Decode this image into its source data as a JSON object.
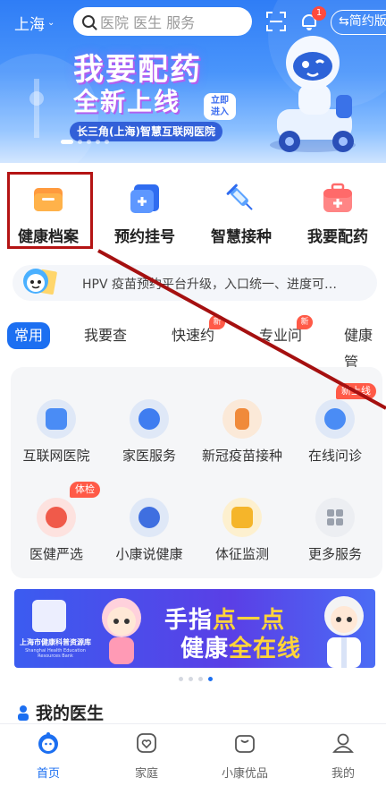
{
  "header": {
    "city": "上海",
    "search_placeholder": "医院 医生 服务",
    "notification_count": "1",
    "simple_mode_label": "简约版"
  },
  "hero_banner": {
    "title_line1": "我要配药",
    "title_line2": "全新上线",
    "enter_label_1": "立即",
    "enter_label_2": "进入",
    "subtitle": "长三角(上海)智慧互联网医院"
  },
  "quick_entries": [
    {
      "label": "健康档案",
      "icon": "folder-icon"
    },
    {
      "label": "预约挂号",
      "icon": "appointment-icon"
    },
    {
      "label": "智慧接种",
      "icon": "syringe-icon"
    },
    {
      "label": "我要配药",
      "icon": "medicine-kit-icon"
    }
  ],
  "notice": {
    "text": "HPV 疫苗预约平台升级，入口统一、进度可…"
  },
  "tabs": [
    {
      "label": "常用",
      "active": true
    },
    {
      "label": "我要查"
    },
    {
      "label": "快速约",
      "badge": "新"
    },
    {
      "label": "专业问",
      "badge": "新"
    },
    {
      "label": "健康管"
    }
  ],
  "services": {
    "corner_ribbon": "新上线",
    "items": [
      {
        "label": "互联网医院",
        "icon": "hospital-icon"
      },
      {
        "label": "家医服务",
        "icon": "family-doctor-icon"
      },
      {
        "label": "新冠疫苗接种",
        "icon": "vaccine-bottle-icon"
      },
      {
        "label": "在线问诊",
        "icon": "online-consult-icon"
      },
      {
        "label": "医健严选",
        "icon": "select-badge-icon",
        "badge": "体检"
      },
      {
        "label": "小康说健康",
        "icon": "graduate-icon"
      },
      {
        "label": "体征监测",
        "icon": "monitor-icon"
      },
      {
        "label": "更多服务",
        "icon": "grid-more-icon"
      }
    ]
  },
  "ad_banner": {
    "org_name": "上海市健康科普资源库",
    "org_name_en": "Shanghai Health Education Resources Bank",
    "line1_a": "手指",
    "line1_b": "点一点",
    "line2_a": "健康",
    "line2_b": "全在线"
  },
  "section_title": "我的医生",
  "bottom_nav": [
    {
      "label": "首页",
      "active": true,
      "icon": "home-icon"
    },
    {
      "label": "家庭",
      "icon": "family-icon"
    },
    {
      "label": "小康优品",
      "icon": "shopping-bag-icon"
    },
    {
      "label": "我的",
      "icon": "profile-icon"
    }
  ],
  "colors": {
    "primary": "#1c6ff1",
    "badge_red": "#ff5a47",
    "highlight_box": "#b41414"
  }
}
